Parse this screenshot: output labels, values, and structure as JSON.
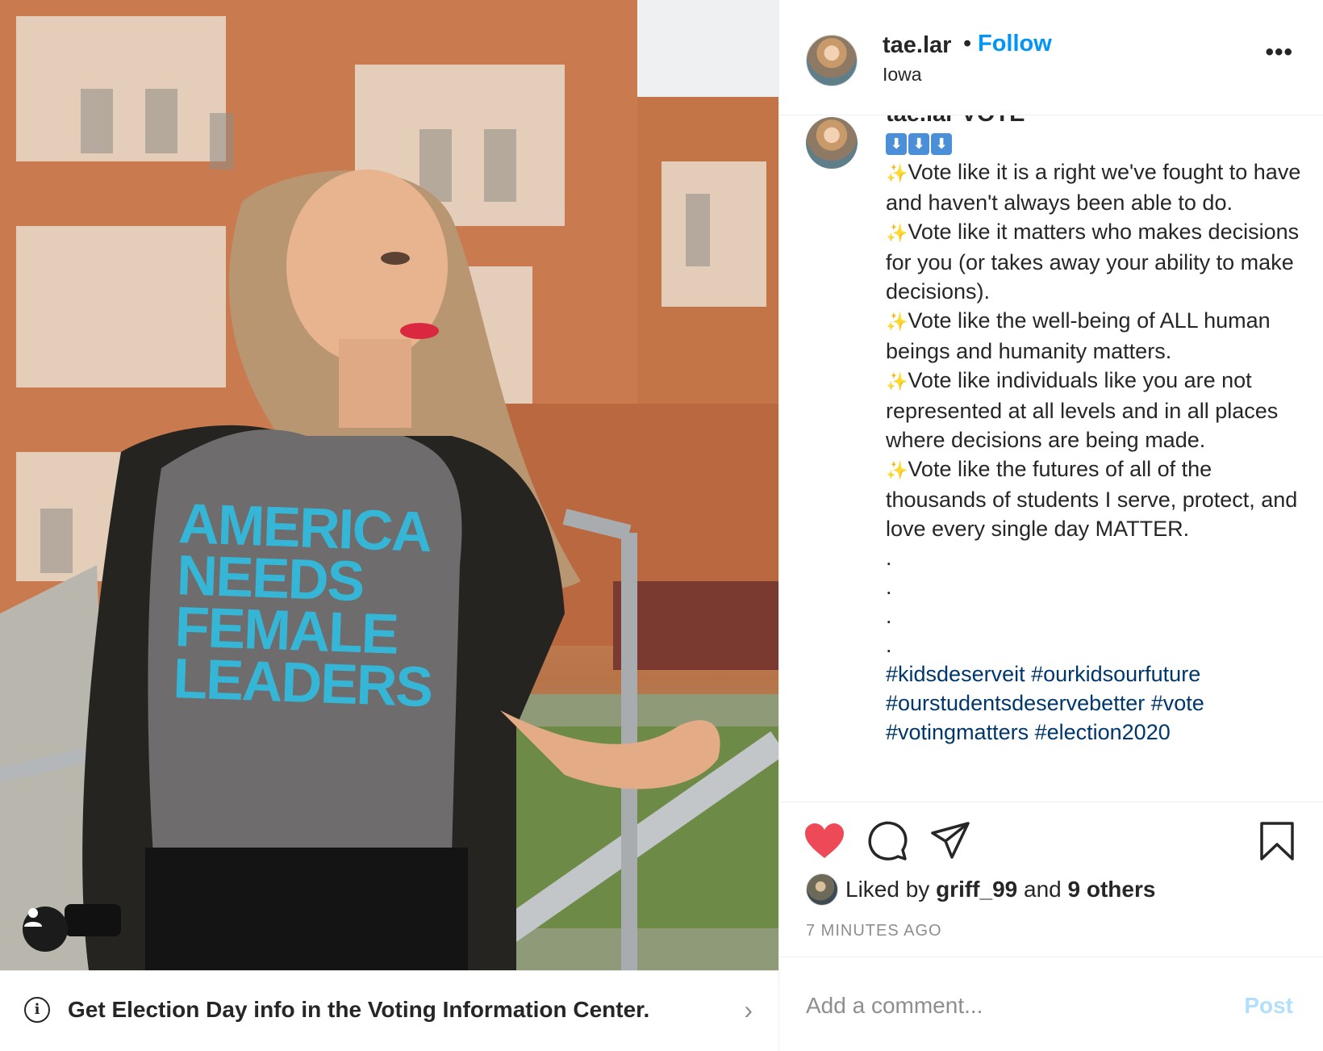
{
  "photo": {
    "shirt_lines": [
      "AMERICA",
      "NEEDS",
      "FEMALE",
      "LEADERS"
    ]
  },
  "voting_banner": {
    "text": "Get Election Day info in the Voting Information Center."
  },
  "header": {
    "username": "tae.lar",
    "separator": "•",
    "follow_label": "Follow",
    "location": "Iowa",
    "more_label": "•••"
  },
  "caption": {
    "top_line": "tae.lar VOTE",
    "arrows": [
      "⬇",
      "⬇",
      "⬇"
    ],
    "lines": [
      "Vote like it is a right we've fought to have and haven't always been able to do.",
      "Vote like it matters who makes decisions for you (or takes away your ability to make decisions).",
      "Vote like the well-being of ALL human beings and humanity matters.",
      "Vote like individuals like you are not represented at all levels and in all places where decisions are being made.",
      "Vote like the futures of all of the thousands of students I serve, protect, and love every single day MATTER."
    ],
    "dots": [
      ".",
      ".",
      ".",
      "."
    ],
    "hashtags": "#kidsdeserveit #ourkidsourfuture #ourstudentsdeservebetter #vote #votingmatters #election2020"
  },
  "actions": {
    "liked_prefix": "Liked by",
    "liked_user": "griff_99",
    "liked_and": "and",
    "liked_others": "9 others",
    "time_ago": "7 MINUTES AGO"
  },
  "comment": {
    "placeholder": "Add a comment...",
    "post_label": "Post"
  },
  "colors": {
    "follow_blue": "#0095f6",
    "heart_red": "#ed4956",
    "hashtag_blue": "#00376b",
    "post_disabled": "#b2dffc"
  }
}
